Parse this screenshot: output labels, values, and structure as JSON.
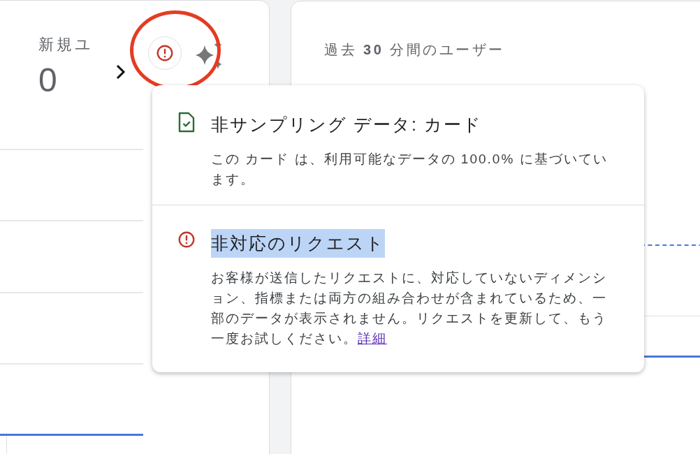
{
  "left_card": {
    "metric_label": "新規ユ",
    "metric_value": "0",
    "has_alert": true,
    "annotated": true
  },
  "right_card": {
    "title": "過去 **30** 分間のユーザー"
  },
  "popover": {
    "sections": [
      {
        "kind": "sampling",
        "title": "非サンプリング データ: カード",
        "title_highlighted": false,
        "body": "この カード は、利用可能なデータの 100.0% に基づいています。"
      },
      {
        "kind": "warning",
        "title": "非対応のリクエスト",
        "title_highlighted": true,
        "body": "お客様が送信したリクエストに、対応していないディメンション、指標または両方の組み合わせが含まれているため、一部のデータが表示されません。リクエストを更新して、もう一度お試しください。",
        "link": "詳細"
      }
    ]
  }
}
